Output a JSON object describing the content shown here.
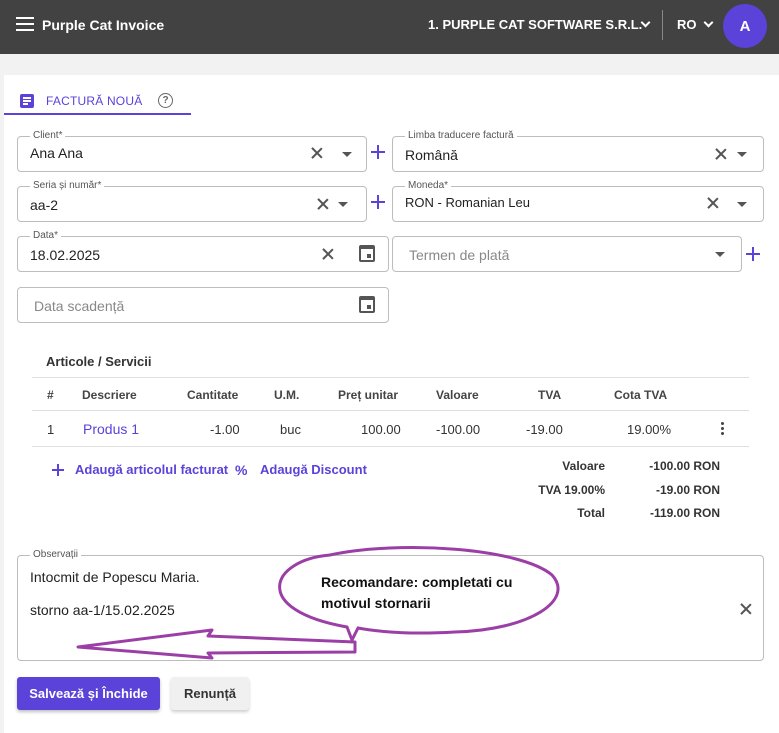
{
  "app": {
    "title": "Purple Cat Invoice"
  },
  "header": {
    "company": "1. PURPLE CAT SOFTWARE S.R.L.",
    "language": "RO",
    "avatar_letter": "A"
  },
  "tab": {
    "label": "FACTURĂ NOUĂ"
  },
  "form": {
    "client": {
      "label": "Client*",
      "value": "Ana Ana"
    },
    "translation_language": {
      "label": "Limba traducere factură",
      "value": "Română"
    },
    "series": {
      "label": "Seria și număr*",
      "value": "aa-2"
    },
    "currency": {
      "label": "Moneda*",
      "value": "RON - Romanian Leu"
    },
    "date": {
      "label": "Data*",
      "value": "18.02.2025"
    },
    "payment_term": {
      "placeholder": "Termen de plată"
    },
    "due_date": {
      "placeholder": "Data scadență"
    }
  },
  "articles": {
    "title": "Articole / Servicii",
    "columns": [
      "#",
      "Descriere",
      "Cantitate",
      "U.M.",
      "Preț unitar",
      "Valoare",
      "TVA",
      "Cota TVA"
    ],
    "rows": [
      {
        "index": "1",
        "description": "Produs 1",
        "quantity": "-1.00",
        "unit": "buc",
        "unit_price": "100.00",
        "value": "-100.00",
        "vat": "-19.00",
        "vat_rate": "19.00%"
      }
    ],
    "add_item_label": "Adaugă articolul facturat",
    "add_discount_label": "Adaugă Discount"
  },
  "totals": [
    {
      "label": "Valoare",
      "value": "-100.00 RON"
    },
    {
      "label": "TVA 19.00%",
      "value": "-19.00 RON"
    },
    {
      "label": "Total",
      "value": "-119.00 RON"
    }
  ],
  "observations": {
    "label": "Observații",
    "line1": "Intocmit de Popescu Maria.",
    "line2": "storno aa-1/15.02.2025"
  },
  "actions": {
    "save": "Salvează și Închide",
    "cancel": "Renunță"
  },
  "annotation": {
    "text": "Recomandare: completati cu motivul stornarii"
  },
  "colors": {
    "accent": "#5b42d9",
    "topbar": "#424242",
    "annotation": "#9b3fa6"
  }
}
